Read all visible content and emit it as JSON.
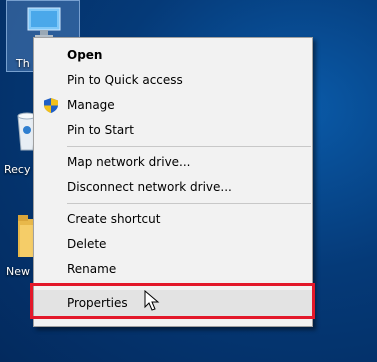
{
  "desktop": {
    "icons": [
      {
        "label": "Th",
        "icon": "this-pc-icon"
      },
      {
        "label": "Recy",
        "icon": "recycle-bin-icon"
      },
      {
        "label": "New",
        "icon": "folder-icon"
      }
    ]
  },
  "context_menu": {
    "items": [
      {
        "label": "Open",
        "bold": true
      },
      {
        "label": "Pin to Quick access"
      },
      {
        "label": "Manage",
        "icon": "uac-shield-icon"
      },
      {
        "label": "Pin to Start"
      },
      {
        "label": "Map network drive..."
      },
      {
        "label": "Disconnect network drive..."
      },
      {
        "label": "Create shortcut"
      },
      {
        "label": "Delete"
      },
      {
        "label": "Rename"
      },
      {
        "label": "Properties",
        "highlighted": true
      }
    ]
  },
  "colors": {
    "highlight_border": "#e3182a",
    "menu_background": "#f2f2f2",
    "hover_background": "#e3e3e3"
  }
}
